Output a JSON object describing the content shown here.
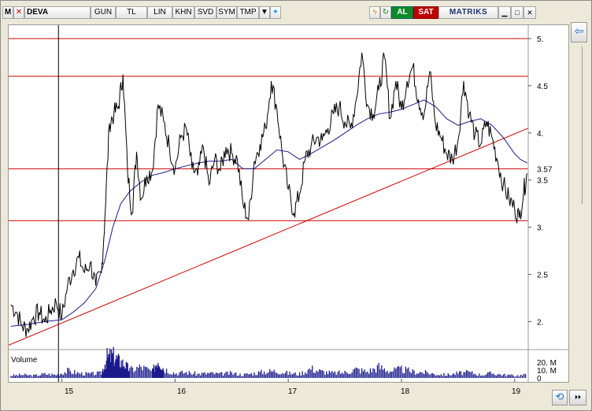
{
  "toolbar": {
    "logo": "M",
    "symbol": "DEVA",
    "period": "GUN",
    "currency": "TL",
    "scale": "LIN",
    "buttons": [
      "KHN",
      "SVD",
      "SYM",
      "TMP"
    ],
    "buy": "AL",
    "sell": "SAT",
    "brand": "MATRIKS"
  },
  "chart_data": {
    "type": "line",
    "symbol": "DEVA",
    "xlabel": "",
    "ylabel": "",
    "x_ticks": [
      "15",
      "16",
      "17",
      "18",
      "19"
    ],
    "y_ticks": [
      "5.",
      "4.5",
      "4.",
      "3.5",
      "3.",
      "2.5",
      "2."
    ],
    "ylim": [
      1.72,
      5.1
    ],
    "xlim": [
      2014.53,
      2019.12
    ],
    "last_price_label": "3.57",
    "last_price": 3.57,
    "price_series": {
      "color": "#000000",
      "points": [
        [
          2014.55,
          2.18
        ],
        [
          2014.6,
          2.1
        ],
        [
          2014.65,
          1.95
        ],
        [
          2014.7,
          1.92
        ],
        [
          2014.75,
          2.05
        ],
        [
          2014.8,
          2.1
        ],
        [
          2014.85,
          2.0
        ],
        [
          2014.9,
          2.12
        ],
        [
          2014.95,
          2.2
        ],
        [
          2015.0,
          2.05
        ],
        [
          2015.05,
          2.38
        ],
        [
          2015.1,
          2.55
        ],
        [
          2015.15,
          2.68
        ],
        [
          2015.2,
          2.52
        ],
        [
          2015.25,
          2.62
        ],
        [
          2015.3,
          2.38
        ],
        [
          2015.35,
          2.52
        ],
        [
          2015.38,
          3.1
        ],
        [
          2015.42,
          4.1
        ],
        [
          2015.46,
          4.2
        ],
        [
          2015.5,
          4.28
        ],
        [
          2015.54,
          4.62
        ],
        [
          2015.58,
          3.6
        ],
        [
          2015.62,
          3.15
        ],
        [
          2015.66,
          3.8
        ],
        [
          2015.7,
          3.3
        ],
        [
          2015.75,
          3.55
        ],
        [
          2015.8,
          3.6
        ],
        [
          2015.85,
          4.3
        ],
        [
          2015.9,
          4.12
        ],
        [
          2015.95,
          3.85
        ],
        [
          2016.0,
          3.62
        ],
        [
          2016.05,
          3.95
        ],
        [
          2016.1,
          4.05
        ],
        [
          2016.15,
          3.62
        ],
        [
          2016.2,
          3.55
        ],
        [
          2016.25,
          3.85
        ],
        [
          2016.3,
          3.45
        ],
        [
          2016.35,
          3.72
        ],
        [
          2016.4,
          3.6
        ],
        [
          2016.45,
          3.85
        ],
        [
          2016.5,
          3.78
        ],
        [
          2016.55,
          3.72
        ],
        [
          2016.6,
          3.25
        ],
        [
          2016.65,
          3.08
        ],
        [
          2016.7,
          3.7
        ],
        [
          2016.75,
          3.88
        ],
        [
          2016.8,
          4.05
        ],
        [
          2016.85,
          4.55
        ],
        [
          2016.9,
          4.25
        ],
        [
          2016.95,
          3.75
        ],
        [
          2017.0,
          3.4
        ],
        [
          2017.05,
          3.15
        ],
        [
          2017.1,
          3.35
        ],
        [
          2017.15,
          3.72
        ],
        [
          2017.2,
          3.85
        ],
        [
          2017.25,
          3.95
        ],
        [
          2017.3,
          3.92
        ],
        [
          2017.35,
          4.05
        ],
        [
          2017.4,
          4.2
        ],
        [
          2017.45,
          4.28
        ],
        [
          2017.5,
          4.12
        ],
        [
          2017.55,
          4.05
        ],
        [
          2017.6,
          4.35
        ],
        [
          2017.65,
          4.85
        ],
        [
          2017.7,
          4.3
        ],
        [
          2017.75,
          4.2
        ],
        [
          2017.8,
          4.45
        ],
        [
          2017.85,
          4.8
        ],
        [
          2017.9,
          4.15
        ],
        [
          2017.95,
          4.55
        ],
        [
          2018.0,
          4.25
        ],
        [
          2018.05,
          4.55
        ],
        [
          2018.1,
          4.7
        ],
        [
          2018.15,
          4.35
        ],
        [
          2018.2,
          4.2
        ],
        [
          2018.25,
          4.65
        ],
        [
          2018.3,
          4.1
        ],
        [
          2018.35,
          3.95
        ],
        [
          2018.4,
          3.78
        ],
        [
          2018.45,
          3.72
        ],
        [
          2018.5,
          3.92
        ],
        [
          2018.55,
          4.55
        ],
        [
          2018.6,
          4.2
        ],
        [
          2018.65,
          3.98
        ],
        [
          2018.7,
          3.88
        ],
        [
          2018.75,
          4.12
        ],
        [
          2018.8,
          3.95
        ],
        [
          2018.85,
          3.7
        ],
        [
          2018.9,
          3.45
        ],
        [
          2018.95,
          3.3
        ],
        [
          2019.0,
          3.2
        ],
        [
          2019.04,
          3.1
        ],
        [
          2019.08,
          3.38
        ],
        [
          2019.11,
          3.57
        ]
      ]
    },
    "moving_average": {
      "color": "#1a1a8c",
      "points": [
        [
          2014.55,
          1.95
        ],
        [
          2014.7,
          1.97
        ],
        [
          2014.85,
          2.0
        ],
        [
          2015.0,
          2.02
        ],
        [
          2015.1,
          2.1
        ],
        [
          2015.2,
          2.2
        ],
        [
          2015.3,
          2.35
        ],
        [
          2015.38,
          2.65
        ],
        [
          2015.45,
          3.0
        ],
        [
          2015.52,
          3.25
        ],
        [
          2015.6,
          3.38
        ],
        [
          2015.7,
          3.48
        ],
        [
          2015.8,
          3.55
        ],
        [
          2015.9,
          3.58
        ],
        [
          2016.0,
          3.62
        ],
        [
          2016.1,
          3.65
        ],
        [
          2016.2,
          3.68
        ],
        [
          2016.3,
          3.7
        ],
        [
          2016.4,
          3.7
        ],
        [
          2016.5,
          3.72
        ],
        [
          2016.6,
          3.62
        ],
        [
          2016.7,
          3.62
        ],
        [
          2016.8,
          3.72
        ],
        [
          2016.9,
          3.82
        ],
        [
          2017.0,
          3.8
        ],
        [
          2017.1,
          3.72
        ],
        [
          2017.2,
          3.78
        ],
        [
          2017.3,
          3.85
        ],
        [
          2017.4,
          3.92
        ],
        [
          2017.5,
          4.0
        ],
        [
          2017.6,
          4.08
        ],
        [
          2017.7,
          4.15
        ],
        [
          2017.8,
          4.2
        ],
        [
          2017.9,
          4.22
        ],
        [
          2018.0,
          4.25
        ],
        [
          2018.1,
          4.3
        ],
        [
          2018.2,
          4.35
        ],
        [
          2018.3,
          4.28
        ],
        [
          2018.4,
          4.15
        ],
        [
          2018.5,
          4.08
        ],
        [
          2018.6,
          4.12
        ],
        [
          2018.7,
          4.15
        ],
        [
          2018.8,
          4.08
        ],
        [
          2018.9,
          3.95
        ],
        [
          2019.0,
          3.78
        ],
        [
          2019.05,
          3.72
        ],
        [
          2019.11,
          3.68
        ]
      ]
    },
    "horizontal_levels": [
      5.0,
      4.6,
      3.62,
      3.07
    ],
    "trendline": {
      "color": "#cc0000",
      "from": [
        2014.53,
        1.75
      ],
      "to": [
        2019.12,
        4.05
      ]
    },
    "cursor_x": 2014.97,
    "volume": {
      "label": "Volume",
      "ticks": [
        "20. M",
        "10. M",
        "0"
      ],
      "ylim": [
        0,
        30
      ],
      "points": [
        [
          2014.55,
          3
        ],
        [
          2014.65,
          4
        ],
        [
          2014.75,
          3
        ],
        [
          2014.85,
          5
        ],
        [
          2014.95,
          4
        ],
        [
          2015.05,
          9
        ],
        [
          2015.15,
          6
        ],
        [
          2015.25,
          5
        ],
        [
          2015.35,
          6
        ],
        [
          2015.4,
          26
        ],
        [
          2015.45,
          28
        ],
        [
          2015.5,
          22
        ],
        [
          2015.55,
          18
        ],
        [
          2015.6,
          10
        ],
        [
          2015.7,
          14
        ],
        [
          2015.8,
          8
        ],
        [
          2015.85,
          24
        ],
        [
          2015.9,
          12
        ],
        [
          2016.0,
          6
        ],
        [
          2016.1,
          7
        ],
        [
          2016.2,
          5
        ],
        [
          2016.3,
          6
        ],
        [
          2016.4,
          5
        ],
        [
          2016.5,
          6
        ],
        [
          2016.6,
          4
        ],
        [
          2016.7,
          6
        ],
        [
          2016.8,
          8
        ],
        [
          2016.9,
          9
        ],
        [
          2017.0,
          6
        ],
        [
          2017.1,
          5
        ],
        [
          2017.2,
          12
        ],
        [
          2017.3,
          8
        ],
        [
          2017.4,
          6
        ],
        [
          2017.5,
          7
        ],
        [
          2017.6,
          11
        ],
        [
          2017.7,
          8
        ],
        [
          2017.8,
          14
        ],
        [
          2017.9,
          9
        ],
        [
          2018.0,
          11
        ],
        [
          2018.1,
          8
        ],
        [
          2018.2,
          7
        ],
        [
          2018.3,
          5
        ],
        [
          2018.4,
          4
        ],
        [
          2018.5,
          6
        ],
        [
          2018.6,
          7
        ],
        [
          2018.7,
          4
        ],
        [
          2018.8,
          6
        ],
        [
          2018.9,
          4
        ],
        [
          2019.0,
          3
        ],
        [
          2019.11,
          4
        ]
      ]
    }
  }
}
